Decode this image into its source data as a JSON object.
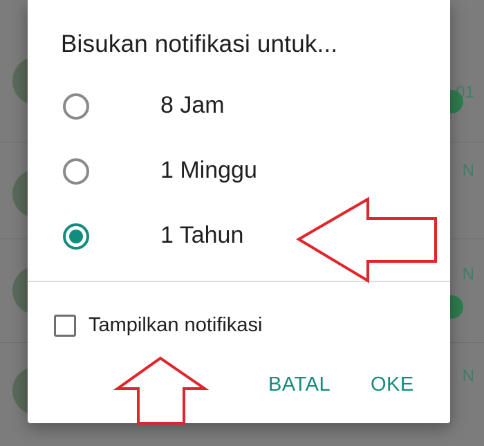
{
  "dialog": {
    "title": "Bisukan notifikasi untuk...",
    "options": [
      {
        "label": "8 Jam",
        "selected": false
      },
      {
        "label": "1 Minggu",
        "selected": false
      },
      {
        "label": "1 Tahun",
        "selected": true
      }
    ],
    "checkbox": {
      "label": "Tampilkan notifikasi",
      "checked": false
    },
    "buttons": {
      "cancel": "BATAL",
      "ok": "OKE"
    }
  },
  "background": {
    "right_text": [
      "01",
      "N",
      "N",
      "N"
    ]
  },
  "colors": {
    "accent": "#128c7e",
    "annotation_arrow": "#e0252b",
    "scrim": "#7c7c7c"
  },
  "annotations": [
    {
      "type": "arrow-left-icon",
      "target": "1 Tahun"
    },
    {
      "type": "arrow-up-icon",
      "target": "Tampilkan notifikasi"
    }
  ]
}
